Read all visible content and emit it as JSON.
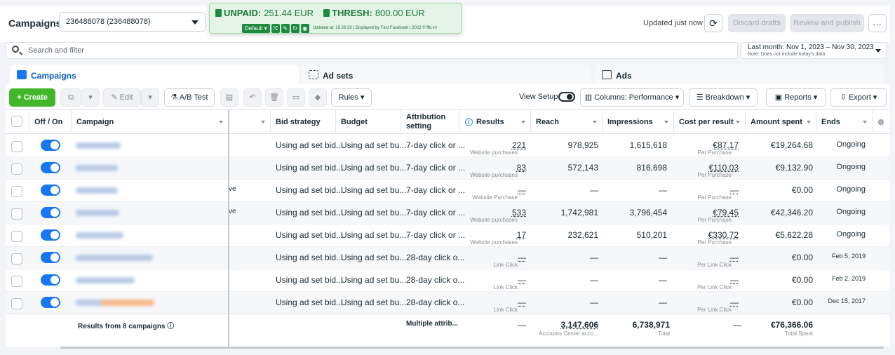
{
  "header": {
    "title": "Campaigns",
    "account": "236488078 (236488078)",
    "updated": "Updated just now",
    "discard": "Discard drafts",
    "review": "Review and publish",
    "more": "..."
  },
  "extension": {
    "unpaid_label": "UNPAID:",
    "unpaid_value": "251.44 EUR",
    "thresh_label": "THRESH:",
    "thresh_value": "800.00 EUR",
    "default_label": "Default",
    "note": "Updated at: 15:26:33 | Displayed by Fast Facebook | 2022 © ffb.vn"
  },
  "search": {
    "placeholder": "Search and filter"
  },
  "date_range": {
    "label": "Last month: Nov 1, 2023 – Nov 30, 2023",
    "note": "Note: Does not include today's data"
  },
  "tabs": [
    "Campaigns",
    "Ad sets",
    "Ads"
  ],
  "toolbar": {
    "create": "Create",
    "edit": "Edit",
    "ab_test": "A/B Test",
    "rules": "Rules",
    "view_setup": "View Setup",
    "columns": "Columns: Performance",
    "breakdown": "Breakdown",
    "reports": "Reports",
    "export": "Export"
  },
  "columns": {
    "off_on": "Off / On",
    "campaign": "Campaign",
    "bid_strategy": "Bid strategy",
    "budget": "Budget",
    "attribution": "Attribution setting",
    "results": "Results",
    "reach": "Reach",
    "impressions": "Impressions",
    "cost_per_result": "Cost per result",
    "amount_spent": "Amount spent",
    "ends": "Ends"
  },
  "rows": [
    {
      "bid": "Using ad set bid...",
      "budget": "Using ad set bu...",
      "attr": "7-day click or ...",
      "results": "221",
      "results_sub": "Website purchases",
      "reach": "978,925",
      "impr": "1,615,618",
      "cpr": "€87.17",
      "cpr_sub": "Per Purchase",
      "spent": "€19,264.68",
      "ends": "Ongoing",
      "clip": ""
    },
    {
      "bid": "Using ad set bid...",
      "budget": "Using ad set bu...",
      "attr": "7-day click or ...",
      "results": "83",
      "results_sub": "Website purchases",
      "reach": "572,143",
      "impr": "816,698",
      "cpr": "€110.03",
      "cpr_sub": "Per Purchase",
      "spent": "€9,132.90",
      "ends": "Ongoing",
      "clip": ""
    },
    {
      "bid": "Using ad set bid...",
      "budget": "Using ad set bu...",
      "attr": "7-day click or ...",
      "results": "—",
      "results_sub": "Website Purchase",
      "reach": "—",
      "impr": "—",
      "cpr": "—",
      "cpr_sub": "Per Purchase",
      "spent": "€0.00",
      "ends": "Ongoing",
      "clip": "ve"
    },
    {
      "bid": "Using ad set bid...",
      "budget": "Using ad set bu...",
      "attr": "7-day click or ...",
      "results": "533",
      "results_sub": "Website purchases",
      "reach": "1,742,981",
      "impr": "3,796,454",
      "cpr": "€79.45",
      "cpr_sub": "Per Purchase",
      "spent": "€42,346.20",
      "ends": "Ongoing",
      "clip": "ve"
    },
    {
      "bid": "Using ad set bid...",
      "budget": "Using ad set bu...",
      "attr": "7-day click or ...",
      "results": "17",
      "results_sub": "Website purchases",
      "reach": "232,621",
      "impr": "510,201",
      "cpr": "€330.72",
      "cpr_sub": "Per Purchase",
      "spent": "€5,622.28",
      "ends": "Ongoing",
      "clip": ""
    },
    {
      "bid": "Using ad set bid...",
      "budget": "Using ad set bu...",
      "attr": "28-day click o...",
      "results": "—",
      "results_sub": "Link Click",
      "reach": "—",
      "impr": "—",
      "cpr": "—",
      "cpr_sub": "Per Link Click",
      "spent": "€0.00",
      "ends": "Feb 5, 2019",
      "clip": ""
    },
    {
      "bid": "Using ad set bid...",
      "budget": "Using ad set bu...",
      "attr": "28-day click o...",
      "results": "—",
      "results_sub": "Link Click",
      "reach": "—",
      "impr": "—",
      "cpr": "—",
      "cpr_sub": "Per Link Click",
      "spent": "€0.00",
      "ends": "Feb 2, 2019",
      "clip": ""
    },
    {
      "bid": "Using ad set bid...",
      "budget": "Using ad set bu...",
      "attr": "28-day click o...",
      "results": "—",
      "results_sub": "Link Click",
      "reach": "—",
      "impr": "—",
      "cpr": "—",
      "cpr_sub": "Per Link Click",
      "spent": "€0.00",
      "ends": "Dec 15, 2017",
      "clip": ""
    }
  ],
  "totals": {
    "label": "Results from 8 campaigns",
    "attr": "Multiple attrib...",
    "results": "—",
    "reach": "3,147,606",
    "reach_sub": "Accounts Center acco...",
    "impr": "6,738,971",
    "impr_sub": "Total",
    "cpr": "—",
    "spent": "€76,366.06",
    "spent_sub": "Total Spent"
  },
  "colors": {
    "accent": "#1877f2",
    "create": "#42b72a",
    "extension": "#1d8a3f"
  }
}
